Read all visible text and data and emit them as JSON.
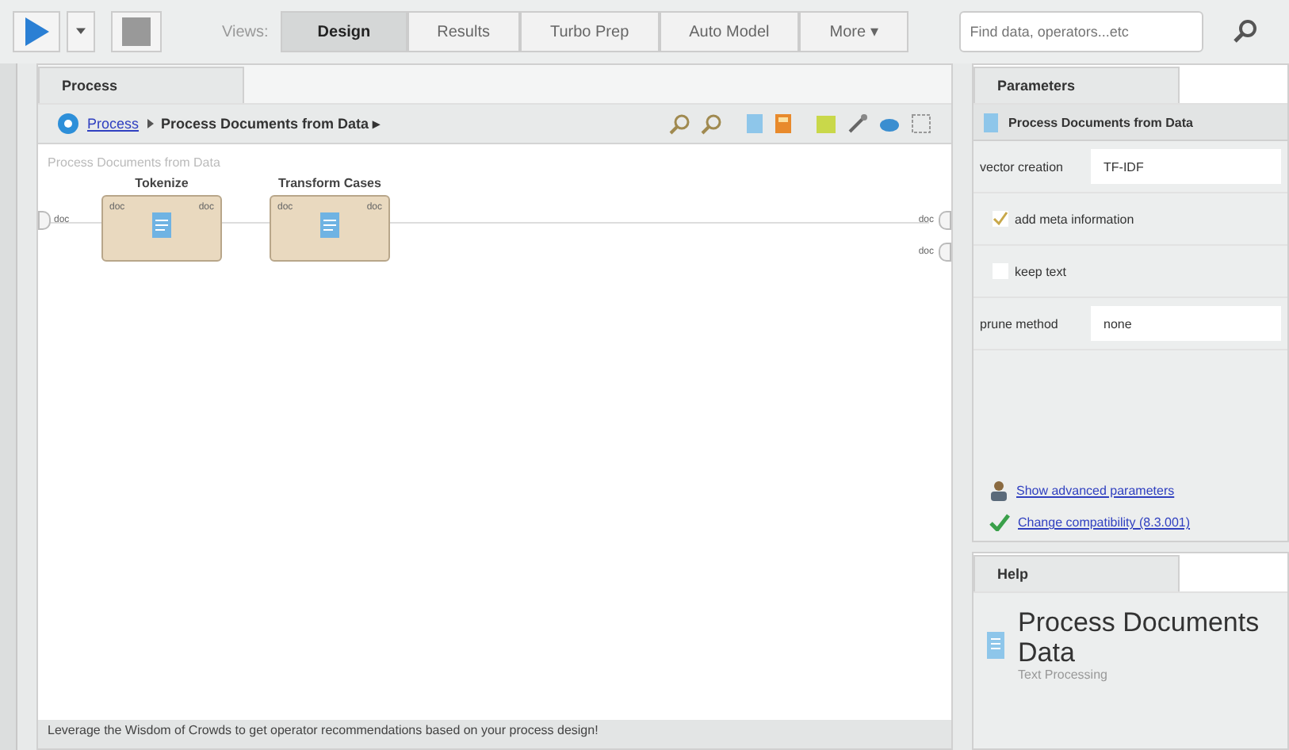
{
  "toolbar": {
    "views_label": "Views:",
    "views": [
      {
        "label": "Design",
        "selected": true
      },
      {
        "label": "Results",
        "selected": false
      },
      {
        "label": "Turbo Prep",
        "selected": false
      },
      {
        "label": "Auto Model",
        "selected": false
      },
      {
        "label": "More ▾",
        "selected": false
      }
    ],
    "search": {
      "placeholder": "Find data, operators...etc"
    }
  },
  "process": {
    "tab": "Process",
    "breadcrumb": {
      "root": "Process",
      "current": "Process Documents from Data ▸"
    },
    "canvas_title": "Process Documents from Data",
    "input_port": "doc",
    "output_ports": [
      "doc",
      "doc"
    ],
    "operators": [
      {
        "name": "Tokenize",
        "in": "doc",
        "out": "doc"
      },
      {
        "name": "Transform Cases",
        "in": "doc",
        "out": "doc"
      }
    ]
  },
  "parameters": {
    "tab": "Parameters",
    "operator": "Process Documents from Data",
    "items": [
      {
        "kind": "select",
        "label": "vector creation",
        "value": "TF-IDF"
      },
      {
        "kind": "checkbox",
        "label": "add meta information",
        "checked": true
      },
      {
        "kind": "checkbox",
        "label": "keep text",
        "checked": false
      },
      {
        "kind": "select",
        "label": "prune method",
        "value": "none"
      }
    ],
    "advanced_link": "Show advanced parameters",
    "compat_link": "Change compatibility (8.3.001)"
  },
  "help": {
    "tab": "Help",
    "title_lines": [
      "Process Documents",
      "Data"
    ],
    "subtitle": "Text Processing"
  },
  "status_bar": "Leverage the Wisdom of Crowds to get operator recommendations based on your process design!"
}
